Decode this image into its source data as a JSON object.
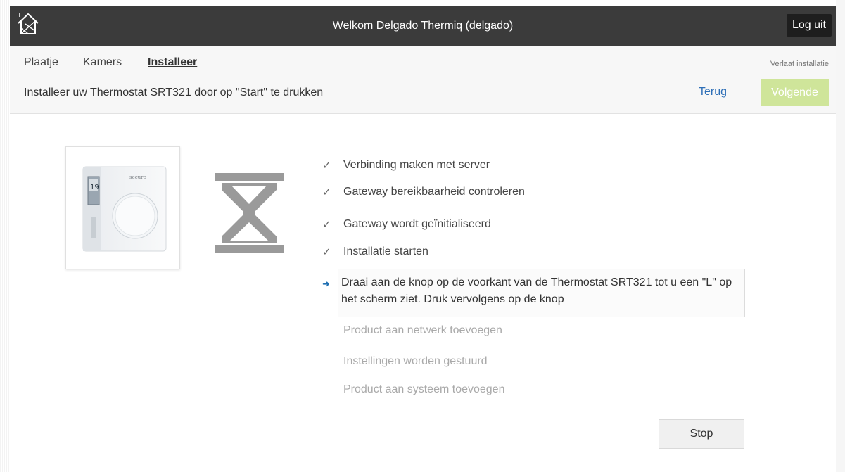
{
  "header": {
    "title": "Welkom Delgado Thermiq (delgado)",
    "logout_label": "Log uit",
    "home_icon": "home-icon"
  },
  "nav": {
    "tabs": [
      {
        "label": "Plaatje",
        "active": false
      },
      {
        "label": "Kamers",
        "active": false
      },
      {
        "label": "Installeer",
        "active": true
      }
    ],
    "leave_label": "Verlaat installatie"
  },
  "instruction": "Installeer uw Thermostat SRT321 door op \"Start\" te drukken",
  "actions": {
    "back_label": "Terug",
    "next_label": "Volgende",
    "next_color": "#cfe59a",
    "stop_label": "Stop"
  },
  "product": {
    "brand": "secure",
    "display": "19"
  },
  "status_icon": "hourglass-icon",
  "steps": [
    {
      "label": "Verbinding maken met server",
      "state": "done"
    },
    {
      "label": "Gateway bereikbaarheid controleren",
      "state": "done"
    },
    {
      "label": "Gateway wordt geïnitialiseerd",
      "state": "done"
    },
    {
      "label": "Installatie starten",
      "state": "done"
    },
    {
      "label": "Draai aan de knop op de voorkant van de Thermostat SRT321 tot u een \"L\" op het scherm ziet. Druk vervolgens op de knop",
      "state": "current"
    },
    {
      "label": "Product aan netwerk toevoegen",
      "state": "pending"
    },
    {
      "label": "Instellingen worden gestuurd",
      "state": "pending"
    },
    {
      "label": "Product aan systeem toevoegen",
      "state": "pending"
    }
  ]
}
